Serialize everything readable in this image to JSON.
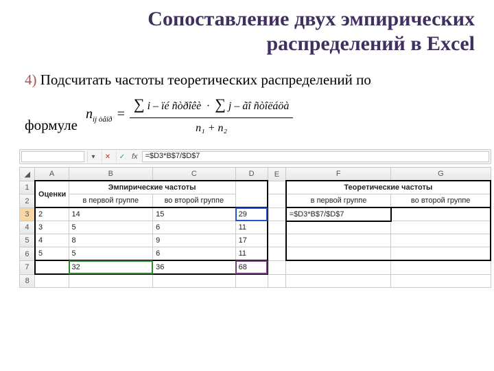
{
  "title_line1": "Сопоставление двух эмпирических",
  "title_line2": "распределений в Excel",
  "step_num": "4)",
  "step_text1": " Подсчитать частоты теоретических распределений по",
  "step_text2": "формуле",
  "formula": {
    "lhs_n": "n",
    "lhs_sub": "ij òåîð",
    "eq": "=",
    "sum1_pre": "i – ïé ñòðîêè",
    "dot": "·",
    "sum2_pre": "j – ãî ñòîëáöà",
    "denom": "n₁ + n₂"
  },
  "formula_bar": {
    "formula_text": "=$D3*B$7/$D$7"
  },
  "cols": [
    "A",
    "B",
    "C",
    "D",
    "E",
    "F",
    "G"
  ],
  "rownums": [
    "1",
    "2",
    "3",
    "4",
    "5",
    "6",
    "7",
    "8"
  ],
  "row1": {
    "A": "Оценки",
    "BC": "Эмпирические частоты",
    "FG": "Теоретические частоты"
  },
  "row2": {
    "B": "в первой группе",
    "C": "во второй группе",
    "F": "в первой группе",
    "G": "во второй группе"
  },
  "data": {
    "r3": {
      "A": "2",
      "B": "14",
      "C": "15",
      "D": "29",
      "F": "=$D3*B$7/$D$7"
    },
    "r4": {
      "A": "3",
      "B": "5",
      "C": "6",
      "D": "11"
    },
    "r5": {
      "A": "4",
      "B": "8",
      "C": "9",
      "D": "17"
    },
    "r6": {
      "A": "5",
      "B": "5",
      "C": "6",
      "D": "11"
    },
    "r7": {
      "B": "32",
      "C": "36",
      "D": "68"
    }
  }
}
